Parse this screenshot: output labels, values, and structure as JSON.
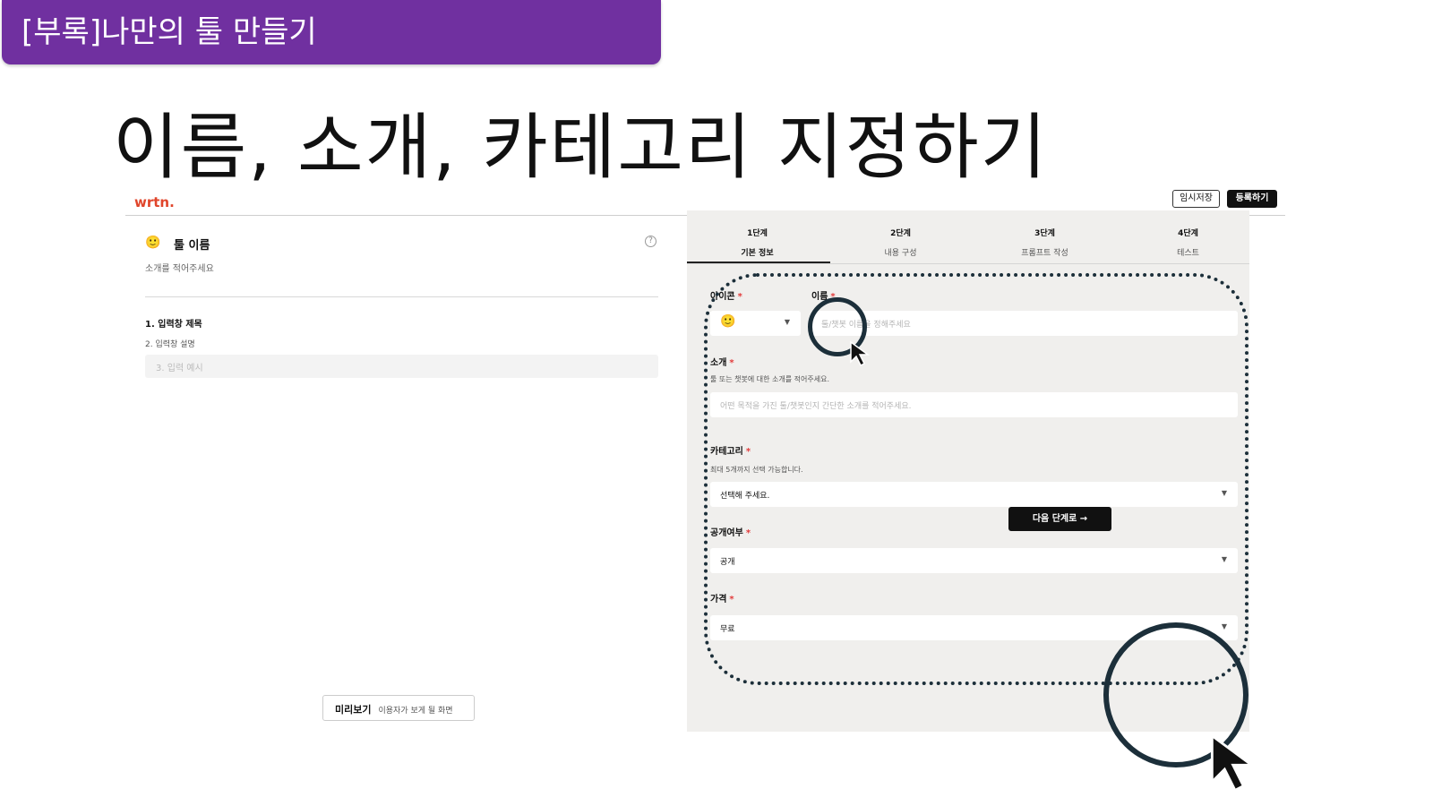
{
  "slide": {
    "tag": "[부록]나만의 툴 만들기",
    "title": "이름, 소개, 카테고리 지정하기"
  },
  "app": {
    "logo": "wrtn.",
    "temp_save_label": "임시저장",
    "register_label": "등록하기",
    "accent_color": "#e0452b"
  },
  "preview_panel": {
    "emoji": "🙂",
    "tool_name": "툴 이름",
    "tool_desc": "소개를 적어주세요",
    "help_icon": "?",
    "field1": "1. 입력창 제목",
    "field2": "2. 입력창 설명",
    "field3": "3. 입력 예시",
    "preview_button": "미리보기",
    "preview_button_sub": "이용자가 보게 될 화면"
  },
  "steps": [
    {
      "num": "1단계",
      "label": "기본 정보"
    },
    {
      "num": "2단계",
      "label": "내용 구성"
    },
    {
      "num": "3단계",
      "label": "프롬프트 작성"
    },
    {
      "num": "4단계",
      "label": "테스트"
    }
  ],
  "form": {
    "icon_label": "아이콘",
    "icon_value": "🙂",
    "name_label": "이름",
    "name_placeholder": "툴/챗봇 이름을 정해주세요",
    "intro_label": "소개",
    "intro_hint": "툴 또는 챗봇에 대한 소개를 적어주세요.",
    "intro_placeholder": "어떤 목적을 가진 툴/챗봇인지 간단한 소개를 적어주세요.",
    "category_label": "카테고리",
    "category_hint": "최대 5개까지 선택 가능합니다.",
    "category_value": "선택해 주세요.",
    "public_label": "공개여부",
    "public_value": "공개",
    "price_label": "가격",
    "price_value": "무료",
    "required_mark": "*",
    "dropdown_glyph": "▼",
    "next_button": "다음 단계로 →"
  }
}
